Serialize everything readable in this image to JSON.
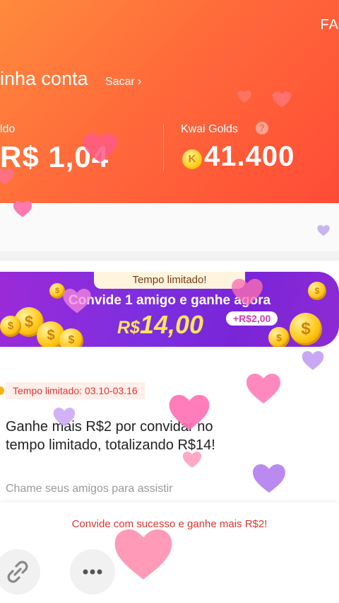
{
  "header": {
    "faq_label": "FA",
    "account_title": "inha conta",
    "sacar_label": "Sacar",
    "sacar_chevron": "›",
    "saldo_label": "ldo",
    "saldo_value": "R$ 1,04",
    "golds_label": "Kwai Golds",
    "help_glyph": "?",
    "coin_glyph": "K",
    "golds_value": "41.400"
  },
  "banner": {
    "tag": "Tempo limitado!",
    "subtitle": "Convide 1 amigo e ganhe agora",
    "currency": "R$",
    "amount": "14,00",
    "bonus": "+R$2,00"
  },
  "promo": {
    "limit_pill": "Tempo limitado: 03.10-03.16",
    "headline": "Ganhe mais R$2 por convidar no tempo limitado, totalizando R$14!",
    "description": "Chame seus amigos para assistir"
  },
  "footer": {
    "success_text": "Convide com sucesso e ganhe mais R$2!",
    "buttons": [
      {
        "icon": "link-icon"
      },
      {
        "icon": "more-icon",
        "glyph": "•••"
      }
    ]
  },
  "colors": {
    "header_start": "#ff8a3d",
    "header_end": "#ff4b37",
    "banner_purple": "#7c2fe0",
    "gold": "#ffe55a",
    "accent_red": "#e0352f"
  }
}
